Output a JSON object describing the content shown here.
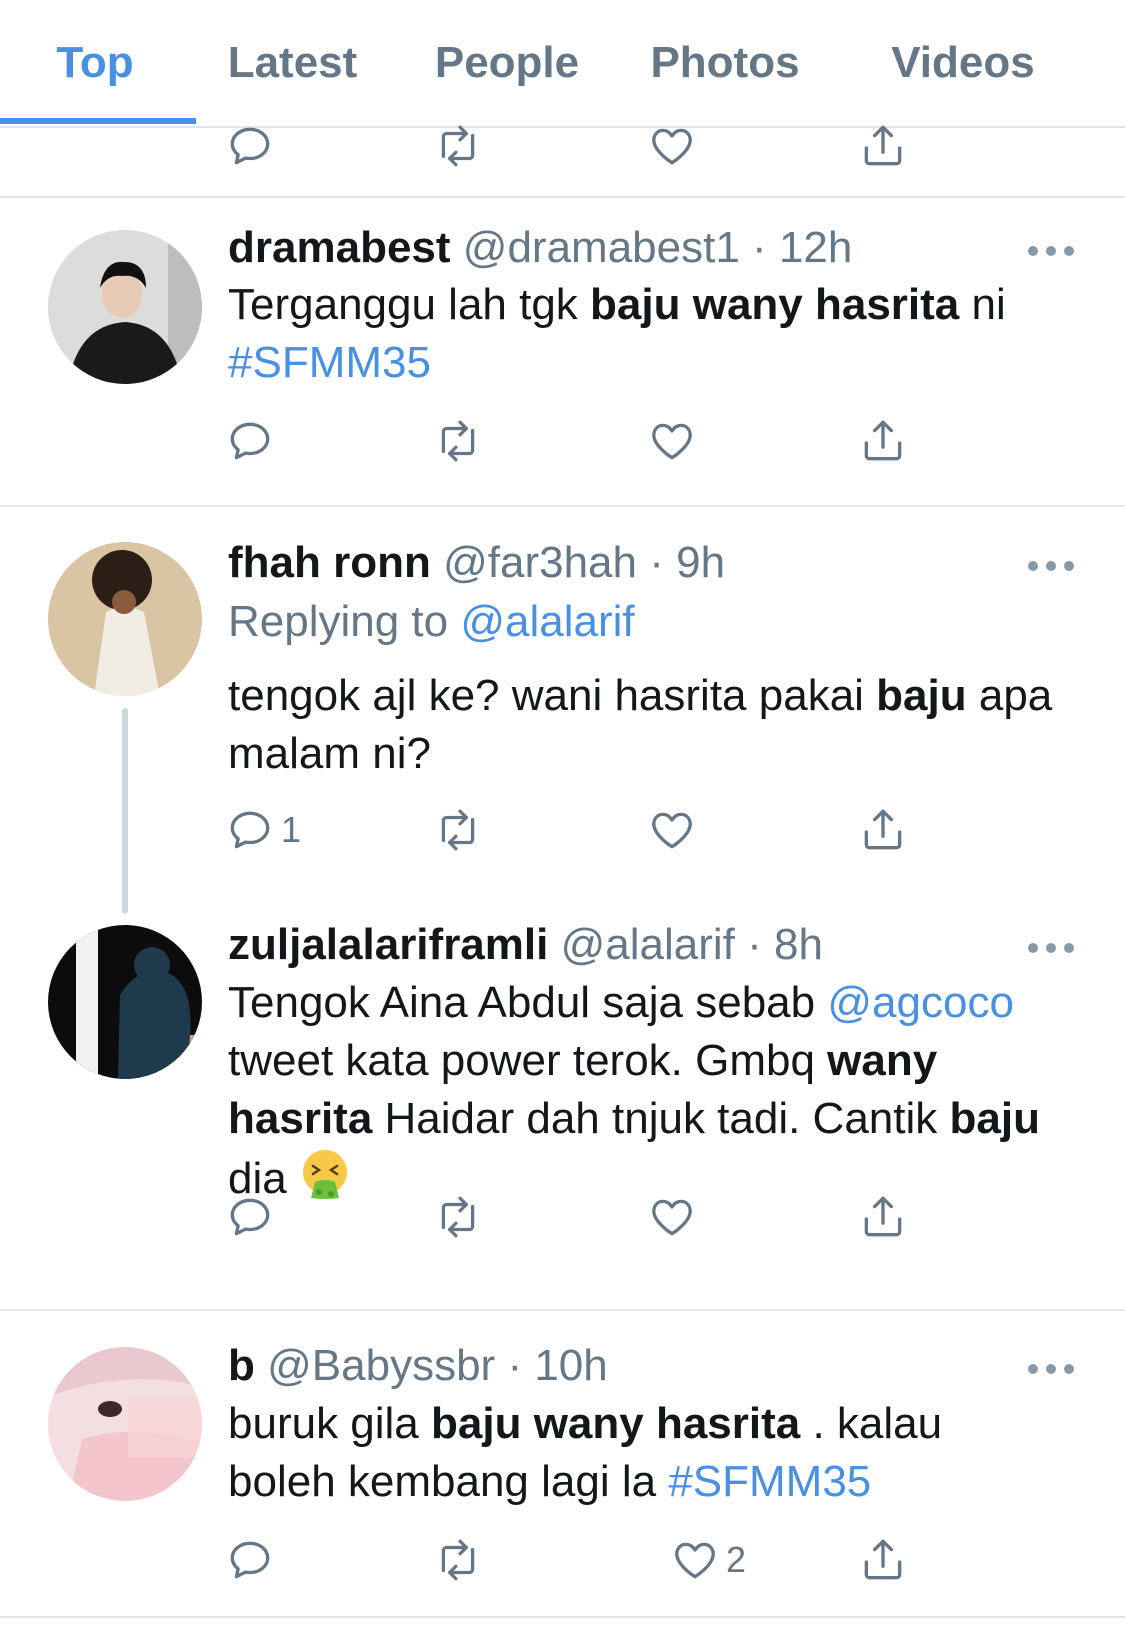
{
  "tabs": [
    {
      "label": "Top",
      "active": true
    },
    {
      "label": "Latest",
      "active": false
    },
    {
      "label": "People",
      "active": false
    },
    {
      "label": "Photos",
      "active": false
    },
    {
      "label": "Videos",
      "active": false
    }
  ],
  "colors": {
    "accent": "#4a90e2",
    "muted": "#657786",
    "text": "#14171a",
    "divider": "#e1e8ed"
  },
  "tweets": [
    {
      "name": "dramabest",
      "handle": "@dramabest1",
      "dot": "·",
      "time": "12h",
      "text": [
        "Terganggu lah tgk ",
        "baju wany hasrita",
        " ni",
        "#SFMM35"
      ],
      "reply_count": "",
      "like_count": ""
    },
    {
      "name": "fhah ronn",
      "handle": "@far3hah",
      "dot": "·",
      "time": "9h",
      "replying_prefix": "Replying to ",
      "replying_to": "@alalarif",
      "text": [
        "tengok ajl ke? wani hasrita pakai ",
        "baju",
        " apa",
        "malam ni?"
      ],
      "reply_count": "1",
      "like_count": ""
    },
    {
      "name": "zuljalalariframli",
      "handle": "@alalarif",
      "dot": "·",
      "time": "8h",
      "text": [
        "Tengok Aina Abdul saja sebab ",
        "@agcoco",
        "tweet kata power terok. Gmbq ",
        "wany",
        "hasrita",
        " Haidar dah tnjuk tadi. Cantik ",
        "baju",
        "dia "
      ],
      "emoji": "vomiting-face-emoji",
      "reply_count": "",
      "like_count": ""
    },
    {
      "name": "b",
      "handle": "@Babyssbr",
      "dot": "·",
      "time": "10h",
      "text": [
        "buruk gila ",
        "baju wany hasrita",
        " . kalau",
        "boleh kembang lagi la ",
        "#SFMM35"
      ],
      "reply_count": "",
      "like_count": "2"
    }
  ]
}
